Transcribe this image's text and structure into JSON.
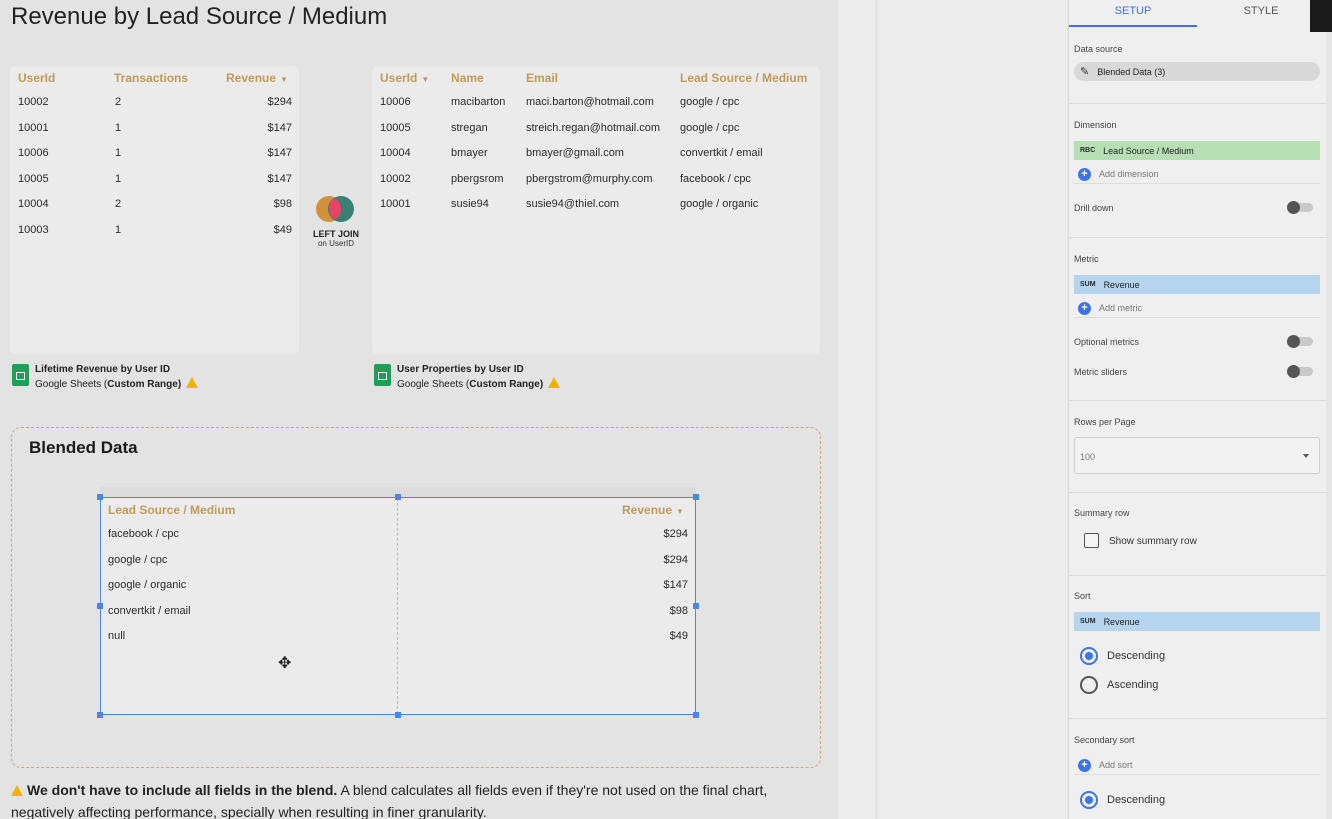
{
  "page_title": "Revenue by Lead Source / Medium",
  "left_table": {
    "headers": [
      "UserId",
      "Transactions",
      "Revenue"
    ],
    "rows": [
      [
        "10002",
        "2",
        "$294"
      ],
      [
        "10001",
        "1",
        "$147"
      ],
      [
        "10006",
        "1",
        "$147"
      ],
      [
        "10005",
        "1",
        "$147"
      ],
      [
        "10004",
        "2",
        "$98"
      ],
      [
        "10003",
        "1",
        "$49"
      ]
    ],
    "source_title": "Lifetime Revenue by User ID",
    "source_sub_prefix": "Google Sheets (",
    "source_sub_bold": "Custom Range",
    "source_sub_suffix": ")"
  },
  "right_table": {
    "headers": [
      "UserId",
      "Name",
      "Email",
      "Lead Source / Medium"
    ],
    "rows": [
      [
        "10006",
        "macibarton",
        "maci.barton@hotmail.com",
        "google / cpc"
      ],
      [
        "10005",
        "stregan",
        "streich.regan@hotmail.com",
        "google / cpc"
      ],
      [
        "10004",
        "bmayer",
        "bmayer@gmail.com",
        "convertkit / email"
      ],
      [
        "10002",
        "pbergsrom",
        "pbergstrom@murphy.com",
        "facebook / cpc"
      ],
      [
        "10001",
        "susie94",
        "susie94@thiel.com",
        "google / organic"
      ]
    ],
    "source_title": "User Properties by User ID",
    "source_sub_prefix": "Google Sheets (",
    "source_sub_bold": "Custom Range",
    "source_sub_suffix": ")"
  },
  "join": {
    "label": "LEFT JOIN",
    "sub": "on UserID"
  },
  "blended": {
    "title": "Blended Data",
    "headers": [
      "Lead Source / Medium",
      "Revenue"
    ],
    "rows": [
      [
        "facebook / cpc",
        "$294"
      ],
      [
        "google / cpc",
        "$294"
      ],
      [
        "google / organic",
        "$147"
      ],
      [
        "convertkit / email",
        "$98"
      ],
      [
        "null",
        "$49"
      ]
    ]
  },
  "footnote": {
    "bold": "We don't have to include all fields in the blend.",
    "rest": " A blend calculates all fields even if they're not used on the final chart, negatively affecting performance, specially when resulting in finer granularity."
  },
  "panel": {
    "tabs": [
      "SETUP",
      "STYLE"
    ],
    "data_source_label": "Data source",
    "data_source_value": "Blended Data (3)",
    "dimension_label": "Dimension",
    "dimension_tag": "RBC",
    "dimension_value": "Lead Source / Medium",
    "add_dimension": "Add dimension",
    "drill_down": "Drill down",
    "metric_label": "Metric",
    "metric_tag": "SUM",
    "metric_value": "Revenue",
    "add_metric": "Add metric",
    "optional_metrics": "Optional metrics",
    "metric_sliders": "Metric sliders",
    "rows_per_page_label": "Rows per Page",
    "rows_per_page_value": "100",
    "summary_row_label": "Summary row",
    "show_summary_row": "Show summary row",
    "sort_label": "Sort",
    "sort_tag": "SUM",
    "sort_value": "Revenue",
    "descending": "Descending",
    "ascending": "Ascending",
    "secondary_sort_label": "Secondary sort",
    "add_sort": "Add sort",
    "secondary_descending": "Descending"
  },
  "colors": {
    "header_gold": "#c19a5b",
    "accent_blue": "#3b74e8",
    "dimension_green": "#b7dfb4",
    "metric_blue": "#b5d5ee",
    "sheets_green": "#1e9e57",
    "warning_yellow": "#f0b400"
  }
}
